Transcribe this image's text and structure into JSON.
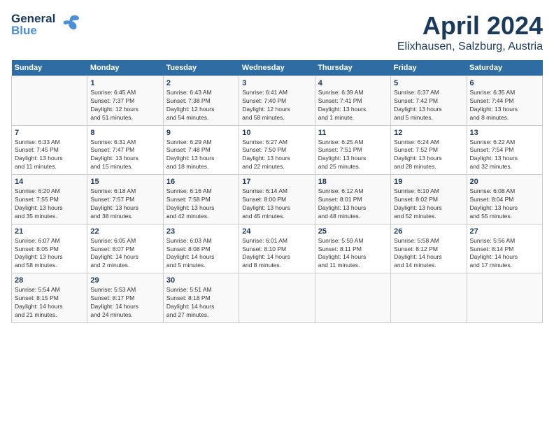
{
  "header": {
    "logo_line1": "General",
    "logo_line2": "Blue",
    "month": "April 2024",
    "location": "Elixhausen, Salzburg, Austria"
  },
  "days_of_week": [
    "Sunday",
    "Monday",
    "Tuesday",
    "Wednesday",
    "Thursday",
    "Friday",
    "Saturday"
  ],
  "weeks": [
    [
      {
        "day": "",
        "info": ""
      },
      {
        "day": "1",
        "info": "Sunrise: 6:45 AM\nSunset: 7:37 PM\nDaylight: 12 hours\nand 51 minutes."
      },
      {
        "day": "2",
        "info": "Sunrise: 6:43 AM\nSunset: 7:38 PM\nDaylight: 12 hours\nand 54 minutes."
      },
      {
        "day": "3",
        "info": "Sunrise: 6:41 AM\nSunset: 7:40 PM\nDaylight: 12 hours\nand 58 minutes."
      },
      {
        "day": "4",
        "info": "Sunrise: 6:39 AM\nSunset: 7:41 PM\nDaylight: 13 hours\nand 1 minute."
      },
      {
        "day": "5",
        "info": "Sunrise: 6:37 AM\nSunset: 7:42 PM\nDaylight: 13 hours\nand 5 minutes."
      },
      {
        "day": "6",
        "info": "Sunrise: 6:35 AM\nSunset: 7:44 PM\nDaylight: 13 hours\nand 8 minutes."
      }
    ],
    [
      {
        "day": "7",
        "info": "Sunrise: 6:33 AM\nSunset: 7:45 PM\nDaylight: 13 hours\nand 11 minutes."
      },
      {
        "day": "8",
        "info": "Sunrise: 6:31 AM\nSunset: 7:47 PM\nDaylight: 13 hours\nand 15 minutes."
      },
      {
        "day": "9",
        "info": "Sunrise: 6:29 AM\nSunset: 7:48 PM\nDaylight: 13 hours\nand 18 minutes."
      },
      {
        "day": "10",
        "info": "Sunrise: 6:27 AM\nSunset: 7:50 PM\nDaylight: 13 hours\nand 22 minutes."
      },
      {
        "day": "11",
        "info": "Sunrise: 6:25 AM\nSunset: 7:51 PM\nDaylight: 13 hours\nand 25 minutes."
      },
      {
        "day": "12",
        "info": "Sunrise: 6:24 AM\nSunset: 7:52 PM\nDaylight: 13 hours\nand 28 minutes."
      },
      {
        "day": "13",
        "info": "Sunrise: 6:22 AM\nSunset: 7:54 PM\nDaylight: 13 hours\nand 32 minutes."
      }
    ],
    [
      {
        "day": "14",
        "info": "Sunrise: 6:20 AM\nSunset: 7:55 PM\nDaylight: 13 hours\nand 35 minutes."
      },
      {
        "day": "15",
        "info": "Sunrise: 6:18 AM\nSunset: 7:57 PM\nDaylight: 13 hours\nand 38 minutes."
      },
      {
        "day": "16",
        "info": "Sunrise: 6:16 AM\nSunset: 7:58 PM\nDaylight: 13 hours\nand 42 minutes."
      },
      {
        "day": "17",
        "info": "Sunrise: 6:14 AM\nSunset: 8:00 PM\nDaylight: 13 hours\nand 45 minutes."
      },
      {
        "day": "18",
        "info": "Sunrise: 6:12 AM\nSunset: 8:01 PM\nDaylight: 13 hours\nand 48 minutes."
      },
      {
        "day": "19",
        "info": "Sunrise: 6:10 AM\nSunset: 8:02 PM\nDaylight: 13 hours\nand 52 minutes."
      },
      {
        "day": "20",
        "info": "Sunrise: 6:08 AM\nSunset: 8:04 PM\nDaylight: 13 hours\nand 55 minutes."
      }
    ],
    [
      {
        "day": "21",
        "info": "Sunrise: 6:07 AM\nSunset: 8:05 PM\nDaylight: 13 hours\nand 58 minutes."
      },
      {
        "day": "22",
        "info": "Sunrise: 6:05 AM\nSunset: 8:07 PM\nDaylight: 14 hours\nand 2 minutes."
      },
      {
        "day": "23",
        "info": "Sunrise: 6:03 AM\nSunset: 8:08 PM\nDaylight: 14 hours\nand 5 minutes."
      },
      {
        "day": "24",
        "info": "Sunrise: 6:01 AM\nSunset: 8:10 PM\nDaylight: 14 hours\nand 8 minutes."
      },
      {
        "day": "25",
        "info": "Sunrise: 5:59 AM\nSunset: 8:11 PM\nDaylight: 14 hours\nand 11 minutes."
      },
      {
        "day": "26",
        "info": "Sunrise: 5:58 AM\nSunset: 8:12 PM\nDaylight: 14 hours\nand 14 minutes."
      },
      {
        "day": "27",
        "info": "Sunrise: 5:56 AM\nSunset: 8:14 PM\nDaylight: 14 hours\nand 17 minutes."
      }
    ],
    [
      {
        "day": "28",
        "info": "Sunrise: 5:54 AM\nSunset: 8:15 PM\nDaylight: 14 hours\nand 21 minutes."
      },
      {
        "day": "29",
        "info": "Sunrise: 5:53 AM\nSunset: 8:17 PM\nDaylight: 14 hours\nand 24 minutes."
      },
      {
        "day": "30",
        "info": "Sunrise: 5:51 AM\nSunset: 8:18 PM\nDaylight: 14 hours\nand 27 minutes."
      },
      {
        "day": "",
        "info": ""
      },
      {
        "day": "",
        "info": ""
      },
      {
        "day": "",
        "info": ""
      },
      {
        "day": "",
        "info": ""
      }
    ]
  ]
}
